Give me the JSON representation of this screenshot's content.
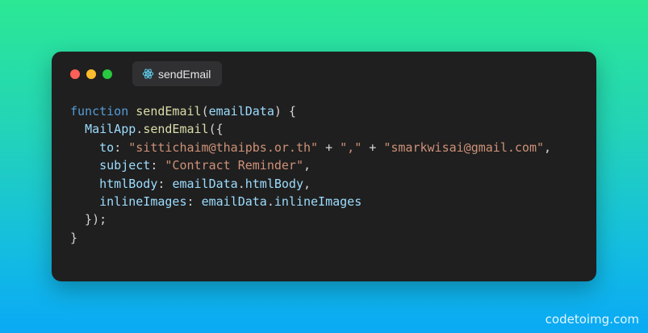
{
  "window": {
    "tab_label": "sendEmail",
    "tab_icon": "react-icon"
  },
  "code": {
    "lines": [
      [
        [
          "kw",
          "function"
        ],
        [
          "pun",
          " "
        ],
        [
          "fn",
          "sendEmail"
        ],
        [
          "pun",
          "("
        ],
        [
          "var",
          "emailData"
        ],
        [
          "pun",
          ") {"
        ]
      ],
      [
        [
          "pun",
          "  "
        ],
        [
          "var",
          "MailApp"
        ],
        [
          "pun",
          "."
        ],
        [
          "fn",
          "sendEmail"
        ],
        [
          "pun",
          "({"
        ]
      ],
      [
        [
          "pun",
          "    "
        ],
        [
          "var",
          "to"
        ],
        [
          "pun",
          ": "
        ],
        [
          "str",
          "\"sittichaim@thaipbs.or.th\""
        ],
        [
          "pun",
          " + "
        ],
        [
          "str",
          "\",\""
        ],
        [
          "pun",
          " + "
        ],
        [
          "str",
          "\"smarkwisai@gmail.com\""
        ],
        [
          "pun",
          ","
        ]
      ],
      [
        [
          "pun",
          "    "
        ],
        [
          "var",
          "subject"
        ],
        [
          "pun",
          ": "
        ],
        [
          "str",
          "\"Contract Reminder\""
        ],
        [
          "pun",
          ","
        ]
      ],
      [
        [
          "pun",
          "    "
        ],
        [
          "var",
          "htmlBody"
        ],
        [
          "pun",
          ": "
        ],
        [
          "var",
          "emailData"
        ],
        [
          "pun",
          "."
        ],
        [
          "var",
          "htmlBody"
        ],
        [
          "pun",
          ","
        ]
      ],
      [
        [
          "pun",
          "    "
        ],
        [
          "var",
          "inlineImages"
        ],
        [
          "pun",
          ": "
        ],
        [
          "var",
          "emailData"
        ],
        [
          "pun",
          "."
        ],
        [
          "var",
          "inlineImages"
        ]
      ],
      [
        [
          "pun",
          "  });"
        ]
      ],
      [
        [
          "pun",
          "}"
        ]
      ]
    ]
  },
  "watermark": "codetoimg.com",
  "colors": {
    "keyword": "#569cd6",
    "function": "#dcdcaa",
    "variable": "#9cdcfe",
    "string": "#ce9178",
    "punctuation": "#d4d4d4"
  }
}
